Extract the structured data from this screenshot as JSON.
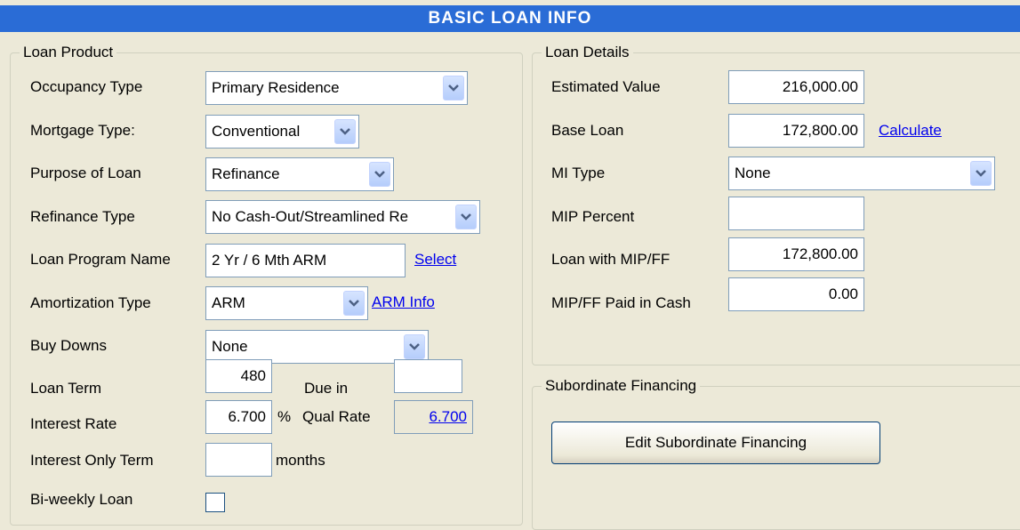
{
  "header": {
    "title": "BASIC LOAN INFO"
  },
  "loan_product": {
    "legend": "Loan Product",
    "occupancy_type": {
      "label": "Occupancy Type",
      "value": "Primary Residence"
    },
    "mortgage_type": {
      "label": "Mortgage Type:",
      "value": "Conventional"
    },
    "purpose_of_loan": {
      "label": "Purpose of Loan",
      "value": "Refinance"
    },
    "refinance_type": {
      "label": "Refinance Type",
      "value": "No Cash-Out/Streamlined Re"
    },
    "loan_program_name": {
      "label": "Loan Program Name",
      "value": "2 Yr / 6 Mth ARM",
      "link": "Select"
    },
    "amortization_type": {
      "label": "Amortization Type",
      "value": "ARM",
      "link": "ARM Info"
    },
    "buy_downs": {
      "label": "Buy Downs",
      "value": "None"
    },
    "loan_term": {
      "label": "Loan Term",
      "value": "480",
      "due_in_label": "Due in",
      "due_in_value": ""
    },
    "interest_rate": {
      "label": "Interest Rate",
      "value": "6.700",
      "unit": "%",
      "qual_rate_label": "Qual Rate",
      "qual_rate_value": "6.700"
    },
    "interest_only_term": {
      "label": "Interest Only Term",
      "value": "",
      "unit": "months"
    },
    "bi_weekly_loan": {
      "label": "Bi-weekly Loan",
      "checked": false
    }
  },
  "loan_details": {
    "legend": "Loan Details",
    "estimated_value": {
      "label": "Estimated Value",
      "value": "216,000.00"
    },
    "base_loan": {
      "label": "Base Loan",
      "value": "172,800.00",
      "link": "Calculate"
    },
    "mi_type": {
      "label": "MI Type",
      "value": "None"
    },
    "mip_percent": {
      "label": "MIP Percent",
      "value": ""
    },
    "loan_with_mip_ff": {
      "label": "Loan with MIP/FF",
      "value": "172,800.00"
    },
    "mip_ff_paid_in_cash": {
      "label": "MIP/FF Paid in Cash",
      "value": "0.00"
    }
  },
  "subordinate_financing": {
    "legend": "Subordinate Financing",
    "edit_button": "Edit Subordinate Financing"
  },
  "colors": {
    "header_bg": "#2a6cd6",
    "panel_bg": "#ece9d8",
    "link": "#0000ee",
    "field_border": "#7f9db9"
  }
}
